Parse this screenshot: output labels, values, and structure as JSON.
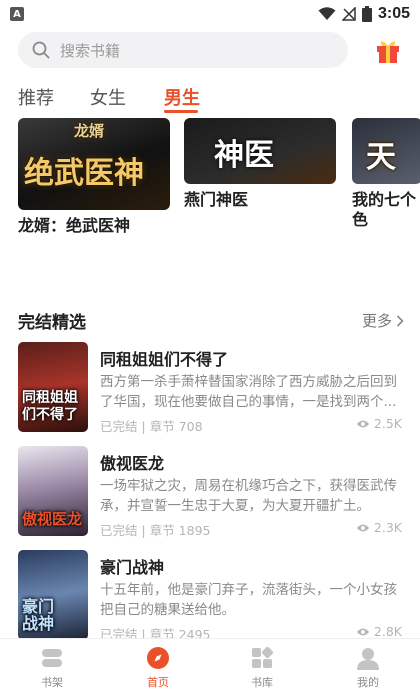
{
  "status_bar": {
    "app_badge": "A",
    "time": "3:05"
  },
  "search": {
    "placeholder": "搜索书籍"
  },
  "tabs": [
    {
      "label": "推荐",
      "active": false
    },
    {
      "label": "女生",
      "active": false
    },
    {
      "label": "男生",
      "active": true
    }
  ],
  "carousel": {
    "items": [
      {
        "title": "龙婿：绝武医神",
        "cover_text_top": "龙婿",
        "cover_text_main": "绝武医神"
      },
      {
        "title": "燕门神医",
        "cover_text_main": "神医"
      },
      {
        "title": "我的七个姐姐绝世风华",
        "title_visible": "我的七个",
        "title_line2": "色",
        "cover_text_main": "天"
      }
    ]
  },
  "section": {
    "title": "完结精选",
    "more_label": "更多"
  },
  "books": [
    {
      "title": "同租姐姐们不得了",
      "desc": "西方第一杀手萧梓替国家消除了西方威胁之后回到了华国，现在他要做自己的事情，一是找到两个...",
      "status": "已完结",
      "chapters": "章节 708",
      "views": "2.5K",
      "cover_text": "同租姐姐们不得了"
    },
    {
      "title": "傲视医龙",
      "desc": "一场牢狱之灾，周易在机缘巧合之下，获得医武传承，并宣誓一生忠于大夏，为大夏开疆扩土。",
      "status": "已完结",
      "chapters": "章节 1895",
      "views": "2.3K",
      "cover_text": "傲视医龙"
    },
    {
      "title": "豪门战神",
      "desc": "十五年前，他是豪门弃子，流落街头，一个小女孩把自己的糖果送给他。",
      "status": "已完结",
      "chapters": "章节 2495",
      "views": "2.8K",
      "cover_text": "豪门战神"
    }
  ],
  "bottom_nav": [
    {
      "label": "书架",
      "icon": "bookshelf-icon",
      "active": false
    },
    {
      "label": "首页",
      "icon": "home-compass-icon",
      "active": true
    },
    {
      "label": "书库",
      "icon": "library-icon",
      "active": false
    },
    {
      "label": "我的",
      "icon": "profile-icon",
      "active": false
    }
  ],
  "colors": {
    "accent": "#e8512a",
    "search_bg": "#f2f2f4",
    "muted": "#8a8a8a"
  }
}
